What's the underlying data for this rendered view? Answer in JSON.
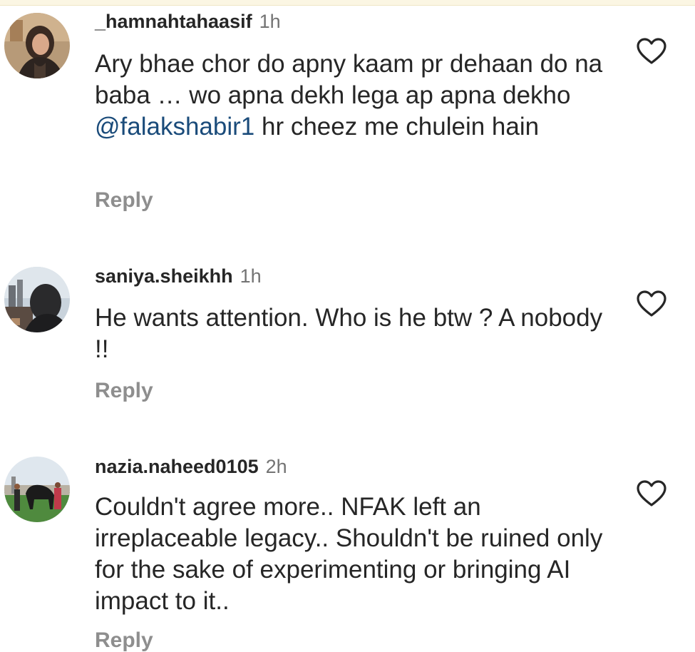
{
  "comments": [
    {
      "username": "_hamnahtahaasif",
      "time": "1h",
      "text_before": "Ary bhae chor do apny kaam pr dehaan do na baba … wo apna dekh lega ap apna dekho ",
      "mention": "@falakshabir1",
      "text_after": " hr cheez me chulein hain",
      "reply_label": "Reply"
    },
    {
      "username": "saniya.sheikhh",
      "time": "1h",
      "text": "He wants attention. Who is he btw ? A nobody !!",
      "reply_label": "Reply"
    },
    {
      "username": "nazia.naheed0105",
      "time": "2h",
      "text": "Couldn't agree more.. NFAK left an irreplaceable legacy.. Shouldn't be ruined only for the sake of experimenting or bringing AI impact to it..",
      "reply_label": "Reply"
    }
  ],
  "icons": {
    "like": "heart-outline-icon"
  },
  "colors": {
    "username": "#262626",
    "timestamp": "#737373",
    "reply": "#8e8e8e",
    "mention": "#1a4b7a"
  }
}
